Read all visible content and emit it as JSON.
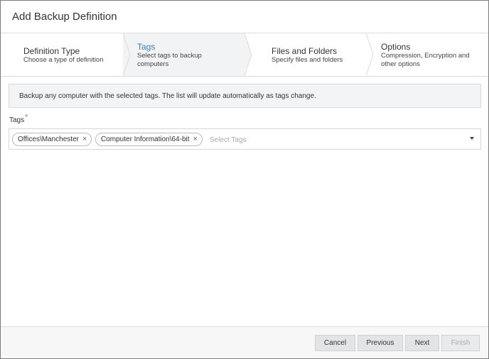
{
  "dialog": {
    "title": "Add Backup Definition"
  },
  "steps": [
    {
      "title": "Definition Type",
      "subtitle_lines": [
        "Choose a type of definition"
      ]
    },
    {
      "title": "Tags",
      "subtitle_lines": [
        "Select tags to backup",
        "computers"
      ]
    },
    {
      "title": "Files and Folders",
      "subtitle_lines": [
        "Specify files and folders"
      ]
    },
    {
      "title": "Options",
      "subtitle_lines": [
        "Compression, Encryption and",
        "other options"
      ]
    }
  ],
  "active_step": "Tags",
  "info": {
    "text": "Backup any computer with the selected tags. The list will update automatically as tags change."
  },
  "tags_field": {
    "label": "Tags",
    "required_marker": "*",
    "selected": [
      "Offices\\Manchester",
      "Computer Information\\64-bit"
    ],
    "remove_glyph": "×",
    "placeholder": "Select Tags",
    "dropdown_icon": "caret-down-icon"
  },
  "footer": {
    "cancel": "Cancel",
    "previous": "Previous",
    "next": "Next",
    "finish": "Finish"
  },
  "colors": {
    "active_step_text": "#3a7dbf",
    "required": "#d9534f",
    "border": "#dcdcdc"
  }
}
